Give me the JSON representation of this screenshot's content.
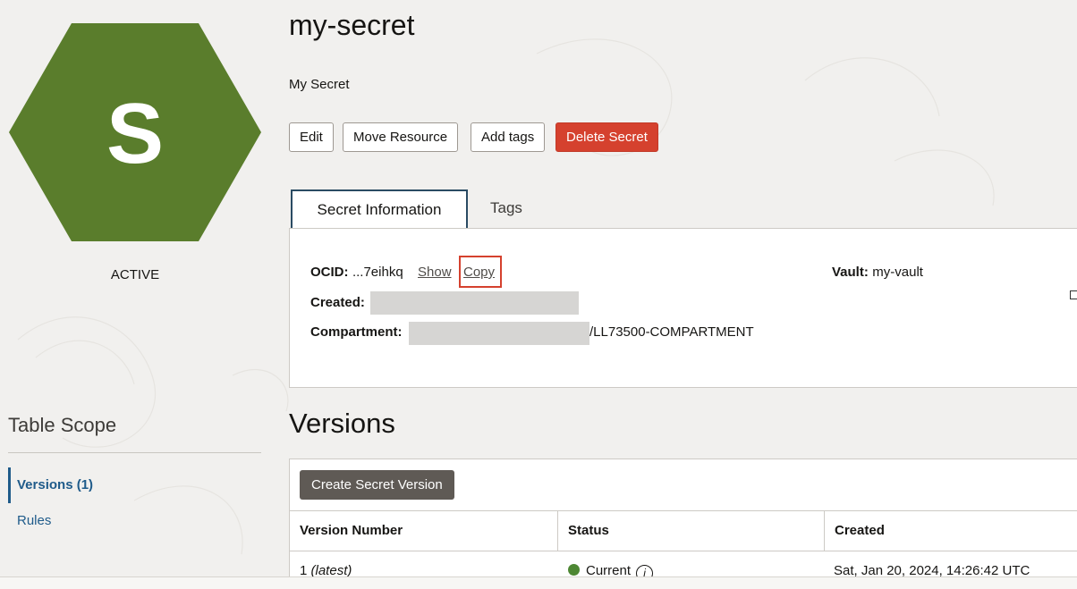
{
  "resource": {
    "initial": "S",
    "hex_color": "#5a7d2c",
    "status": "ACTIVE",
    "name": "my-secret",
    "description": "My Secret"
  },
  "actions": {
    "edit": "Edit",
    "move": "Move Resource",
    "add_tags": "Add tags",
    "delete": "Delete Secret"
  },
  "tabs": {
    "info": "Secret Information",
    "tags": "Tags"
  },
  "info": {
    "ocid_label": "OCID:",
    "ocid_value": "...7eihkq",
    "show": "Show",
    "copy": "Copy",
    "created_label": "Created:",
    "compartment_label": "Compartment:",
    "compartment_suffix": "/LL73500-COMPARTMENT",
    "vault_label": "Vault:",
    "vault_value": "my-vault"
  },
  "scope": {
    "title": "Table Scope",
    "items": [
      "Versions (1)",
      "Rules"
    ]
  },
  "versions": {
    "title": "Versions",
    "create_button": "Create Secret Version",
    "columns": [
      "Version Number",
      "Status",
      "Created"
    ],
    "row": {
      "number": "1",
      "latest": "(latest)",
      "status": "Current",
      "created": "Sat, Jan 20, 2024, 14:26:42 UTC"
    }
  },
  "colors": {
    "accent": "#1f5b8a",
    "danger": "#d5412e",
    "status_current": "#4d8733"
  }
}
